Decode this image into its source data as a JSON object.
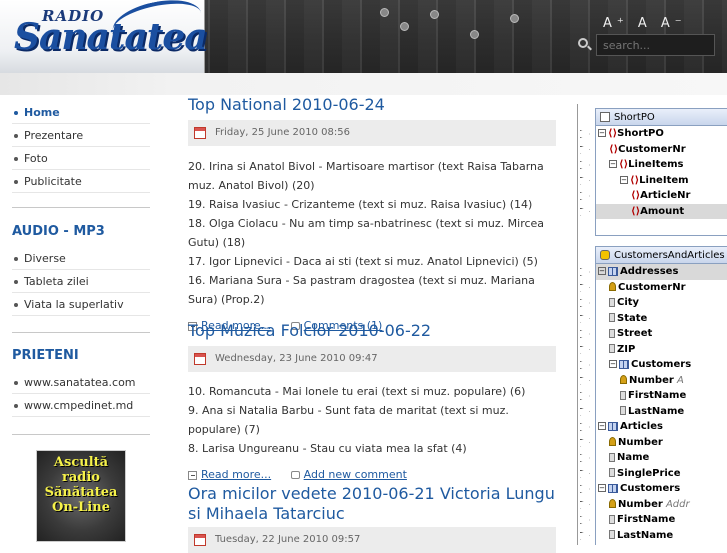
{
  "header": {
    "logo_radio": "RADIO",
    "logo_name": "Sanatatea",
    "font_tools": "A⁺ A A⁻",
    "search_placeholder": "search..."
  },
  "nav": {
    "items": [
      {
        "label": "Home",
        "active": true
      },
      {
        "label": "Prezentare"
      },
      {
        "label": "Foto"
      },
      {
        "label": "Publicitate"
      }
    ]
  },
  "audio": {
    "heading": "AUDIO - MP3",
    "items": [
      {
        "label": "Diverse"
      },
      {
        "label": "Tableta zilei"
      },
      {
        "label": "Viata la superlativ"
      }
    ]
  },
  "friends": {
    "heading": "PRIETENI",
    "items": [
      {
        "label": "www.sanatatea.com"
      },
      {
        "label": "www.cmpedinet.md"
      }
    ]
  },
  "banner": {
    "lines": [
      "Ascultă",
      "radio",
      "Sănătatea",
      "On-Line"
    ]
  },
  "articles": [
    {
      "title": "Top National 2010-06-24",
      "date": "Friday, 25 June 2010 08:56",
      "lines": [
        "20. Irina si Anatol Bivol - Martisoare martisor (text Raisa Tabarna muz. Anatol Bivol) (20)",
        "19. Raisa Ivasiuc - Crizanteme (text si muz. Raisa Ivasiuc) (14)",
        "18. Olga Ciolacu - Nu am timp sa-nbatrinesc (text si muz. Mircea Gutu) (18)",
        "17. Igor Lipnevici - Daca ai sti (text si muz. Anatol Lipnevici) (5)",
        "16. Mariana Sura - Sa pastram dragostea (text si muz. Mariana Sura) (Prop.2)"
      ],
      "read_more": "Read more...",
      "comment": "Comments (1)"
    },
    {
      "title": "Top Muzica Folclor 2010-06-22",
      "date": "Wednesday, 23 June 2010 09:47",
      "lines": [
        "10. Romancuta - Mai lonele tu erai (text si muz. populare) (6)",
        "9. Ana si Natalia Barbu - Sunt fata de maritat (text si muz. populare) (7)",
        "8. Larisa Ungureanu - Stau cu viata mea la sfat (4)"
      ],
      "read_more": "Read more...",
      "comment": "Add new comment"
    },
    {
      "title": "Ora micilor vedete 2010-06-21 Victoria Lungu si Mihaela Tatarciuc",
      "date": "Tuesday, 22 June 2010 09:57"
    }
  ],
  "xml_panel": {
    "panel1": {
      "title": "ShortPO",
      "nodes": [
        {
          "label": "ShortPO",
          "depth": 0,
          "type": "element",
          "expander": "-"
        },
        {
          "label": "CustomerNr",
          "depth": 1,
          "type": "element"
        },
        {
          "label": "LineItems",
          "depth": 1,
          "type": "element",
          "expander": "-"
        },
        {
          "label": "LineItem",
          "depth": 2,
          "type": "element",
          "expander": "-"
        },
        {
          "label": "ArticleNr",
          "depth": 3,
          "type": "element"
        },
        {
          "label": "Amount",
          "depth": 3,
          "type": "element",
          "highlight": true
        }
      ]
    },
    "panel2": {
      "title": "CustomersAndArticles",
      "nodes": [
        {
          "label": "Addresses",
          "depth": 0,
          "type": "table",
          "expander": "-",
          "highlight": true
        },
        {
          "label": "CustomerNr",
          "depth": 1,
          "type": "key"
        },
        {
          "label": "City",
          "depth": 1,
          "type": "field"
        },
        {
          "label": "State",
          "depth": 1,
          "type": "field"
        },
        {
          "label": "Street",
          "depth": 1,
          "type": "field"
        },
        {
          "label": "ZIP",
          "depth": 1,
          "type": "field"
        },
        {
          "label": "Customers",
          "depth": 1,
          "type": "table",
          "expander": "-"
        },
        {
          "label": "Number",
          "depth": 2,
          "type": "key",
          "note": "A"
        },
        {
          "label": "FirstName",
          "depth": 2,
          "type": "field"
        },
        {
          "label": "LastName",
          "depth": 2,
          "type": "field"
        },
        {
          "label": "Articles",
          "depth": 0,
          "type": "table",
          "expander": "-"
        },
        {
          "label": "Number",
          "depth": 1,
          "type": "key"
        },
        {
          "label": "Name",
          "depth": 1,
          "type": "field"
        },
        {
          "label": "SinglePrice",
          "depth": 1,
          "type": "field"
        },
        {
          "label": "Customers",
          "depth": 0,
          "type": "table",
          "expander": "-"
        },
        {
          "label": "Number",
          "depth": 1,
          "type": "key",
          "note": "Addr"
        },
        {
          "label": "FirstName",
          "depth": 1,
          "type": "field"
        },
        {
          "label": "LastName",
          "depth": 1,
          "type": "field"
        }
      ]
    }
  }
}
